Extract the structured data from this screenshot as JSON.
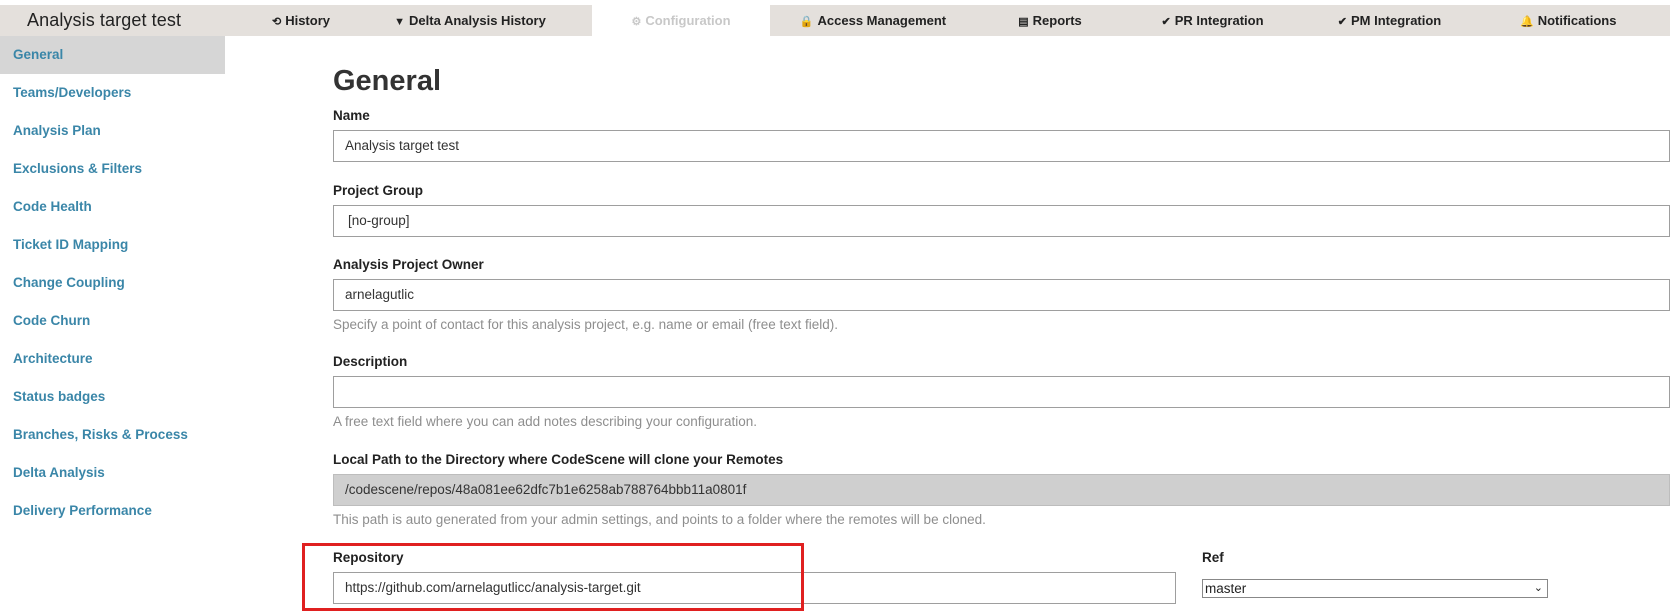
{
  "app": {
    "title": "Analysis target test"
  },
  "nav": {
    "items": [
      {
        "icon": "history-icon",
        "glyph": "⟲",
        "label": "History"
      },
      {
        "icon": "filter-icon",
        "glyph": "▼",
        "label": "Delta Analysis History"
      },
      {
        "icon": "gears-icon",
        "glyph": "⚙",
        "label": "Configuration"
      },
      {
        "icon": "lock-icon",
        "glyph": "🔒",
        "label": "Access Management"
      },
      {
        "icon": "document-icon",
        "glyph": "▤",
        "label": "Reports"
      },
      {
        "icon": "check-icon",
        "glyph": "✔",
        "label": "PR Integration"
      },
      {
        "icon": "check-icon",
        "glyph": "✔",
        "label": "PM Integration"
      },
      {
        "icon": "bell-icon",
        "glyph": "🔔",
        "label": "Notifications"
      }
    ],
    "active": "Configuration"
  },
  "sidebar": {
    "items": [
      {
        "label": "General"
      },
      {
        "label": "Teams/Developers"
      },
      {
        "label": "Analysis Plan"
      },
      {
        "label": "Exclusions & Filters"
      },
      {
        "label": "Code Health"
      },
      {
        "label": "Ticket ID Mapping"
      },
      {
        "label": "Change Coupling"
      },
      {
        "label": "Code Churn"
      },
      {
        "label": "Architecture"
      },
      {
        "label": "Status badges"
      },
      {
        "label": "Branches, Risks & Process"
      },
      {
        "label": "Delta Analysis"
      },
      {
        "label": "Delivery Performance"
      }
    ],
    "active": "General"
  },
  "main": {
    "title": "General",
    "name": {
      "label": "Name",
      "value": "Analysis target test"
    },
    "project_group": {
      "label": "Project Group",
      "value": "[no-group]"
    },
    "owner": {
      "label": "Analysis Project Owner",
      "value": "arnelagutlic",
      "help": "Specify a point of contact for this analysis project, e.g. name or email (free text field)."
    },
    "description": {
      "label": "Description",
      "value": "",
      "help": "A free text field where you can add notes describing your configuration."
    },
    "local_path": {
      "label": "Local Path to the Directory where CodeScene will clone your Remotes",
      "value": "/codescene/repos/48a081ee62dfc7b1e6258ab788764bbb11a0801f",
      "help": "This path is auto generated from your admin settings, and points to a folder where the remotes will be cloned."
    },
    "repository": {
      "label": "Repository",
      "value": "https://github.com/arnelagutlicc/analysis-target.git"
    },
    "ref": {
      "label": "Ref",
      "value": "master"
    }
  },
  "colors": {
    "topbar_bg": "#e4e0dc",
    "link": "#3a86a8",
    "sidebar_active_bg": "#d6d6d6",
    "highlight_border": "#e02020",
    "disabled_input_bg": "#cfcfcf"
  }
}
